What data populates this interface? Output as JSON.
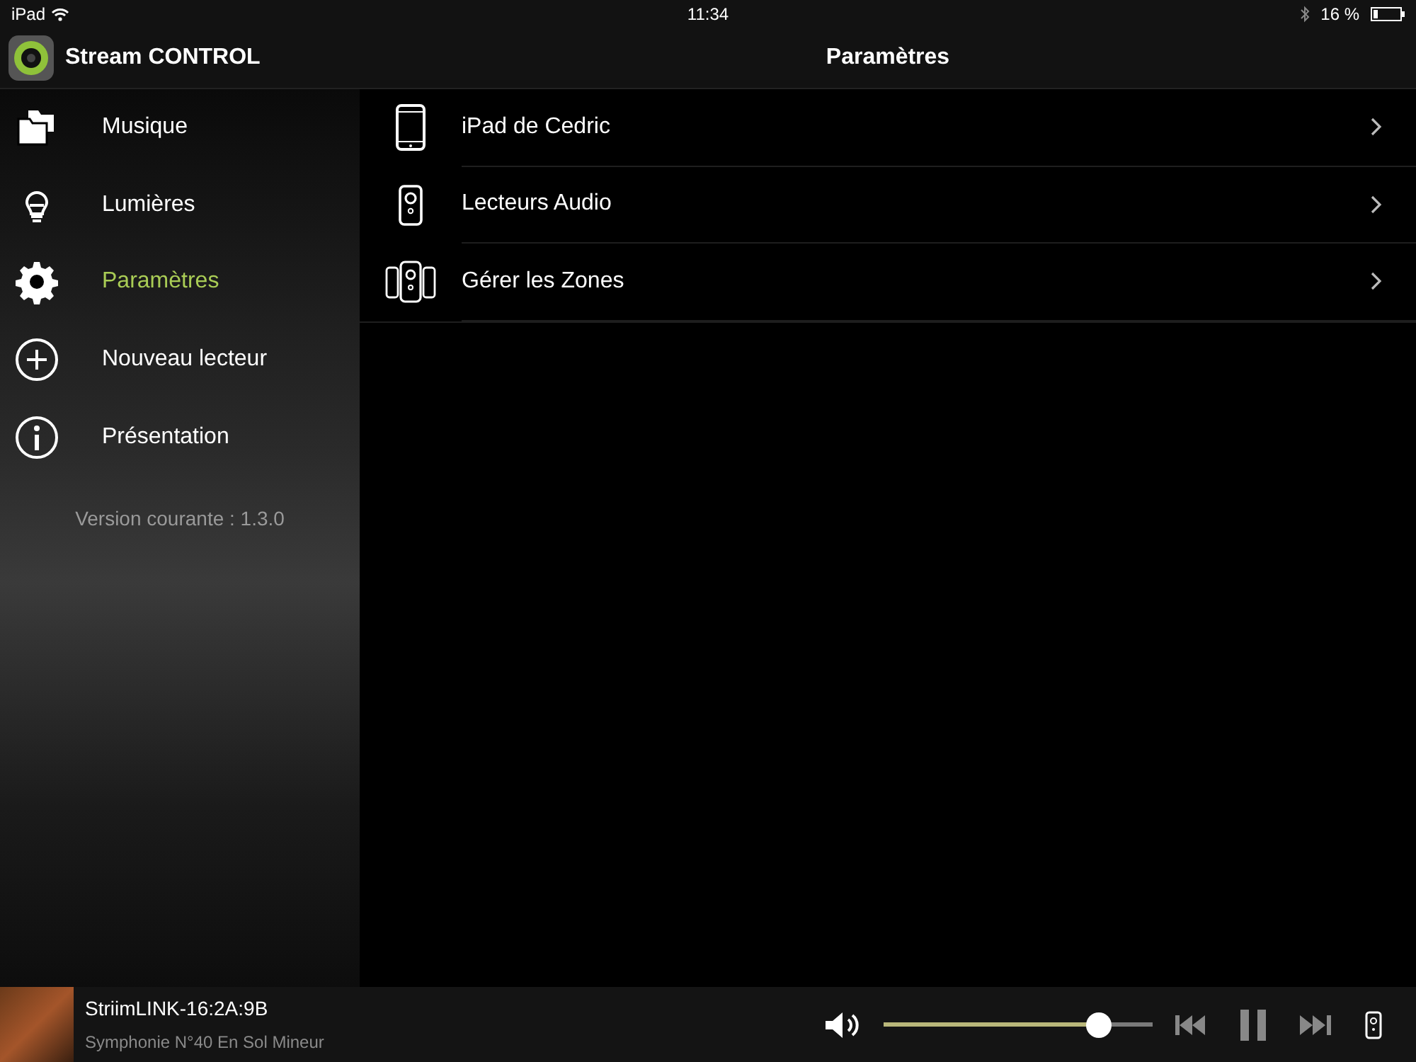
{
  "status_bar": {
    "device": "iPad",
    "time": "11:34",
    "battery": "16 %"
  },
  "header": {
    "app_title": "Stream CONTROL",
    "page_title": "Paramètres"
  },
  "sidebar": {
    "items": [
      {
        "label": "Musique",
        "selected": false
      },
      {
        "label": "Lumières",
        "selected": false
      },
      {
        "label": "Paramètres",
        "selected": true
      },
      {
        "label": "Nouveau lecteur",
        "selected": false
      },
      {
        "label": "Présentation",
        "selected": false
      }
    ],
    "version": "Version courante : 1.3.0"
  },
  "settings": [
    {
      "label": "iPad de Cedric"
    },
    {
      "label": "Lecteurs Audio"
    },
    {
      "label": "Gérer les Zones"
    }
  ],
  "player": {
    "device": "StriimLINK-16:2A:9B",
    "track": "Symphonie N°40 En Sol Mineur",
    "volume": {
      "level": 0.8
    }
  }
}
